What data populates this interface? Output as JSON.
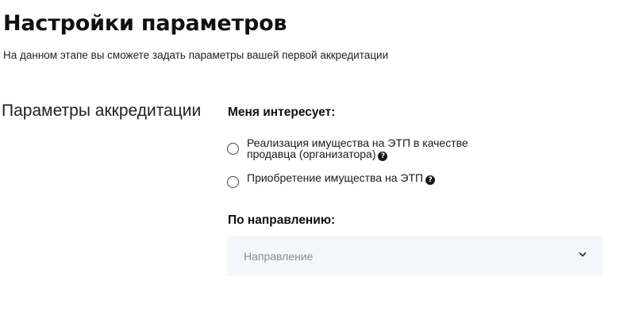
{
  "header": {
    "title": "Настройки параметров",
    "subtitle": "На данном этапе вы сможете задать параметры вашей первой аккредитации"
  },
  "section": {
    "title": "Параметры аккредитации"
  },
  "interest": {
    "label": "Меня интересует:",
    "options": [
      {
        "label": "Реализация имущества на ЭТП в качестве продавца (организатора)",
        "selected": false,
        "help_icon": "question-circle-icon"
      },
      {
        "label": "Приобретение имущества на ЭТП",
        "selected": false,
        "help_icon": "question-circle-icon"
      }
    ]
  },
  "direction": {
    "label": "По направлению:",
    "placeholder": "Направление",
    "icon": "chevron-down-icon"
  },
  "colors": {
    "text": "#1a1a1a",
    "select_bg": "#f3f6fa",
    "placeholder": "#8a8e94"
  }
}
